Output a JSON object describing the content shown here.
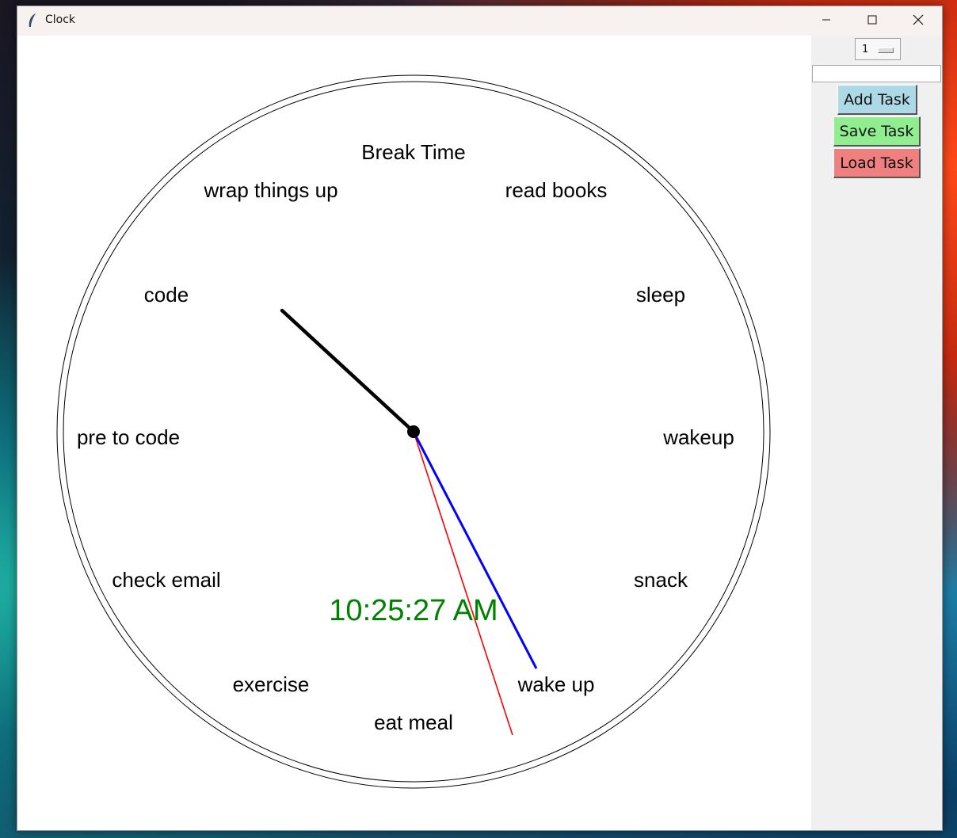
{
  "window": {
    "title": "Clock"
  },
  "clock": {
    "task_labels": [
      "Break Time",
      "read books",
      "sleep",
      "wakeup",
      "snack",
      "wake up",
      "eat meal",
      "exercise",
      "check email",
      "pre to code",
      "code",
      "wrap things up"
    ],
    "digital_time": "10:25:27 AM",
    "digital_color": "#008000",
    "hour_hand_color": "#000000",
    "minute_hand_color": "#0000ff",
    "second_hand_color": "#ff0000"
  },
  "sidepanel": {
    "spinbox_value": "1",
    "task_input_value": "",
    "add_task_label": "Add Task",
    "save_task_label": "Save Task",
    "load_task_label": "Load Task",
    "add_color": "#add8e6",
    "save_color": "#90ee90",
    "load_color": "#f08080"
  }
}
